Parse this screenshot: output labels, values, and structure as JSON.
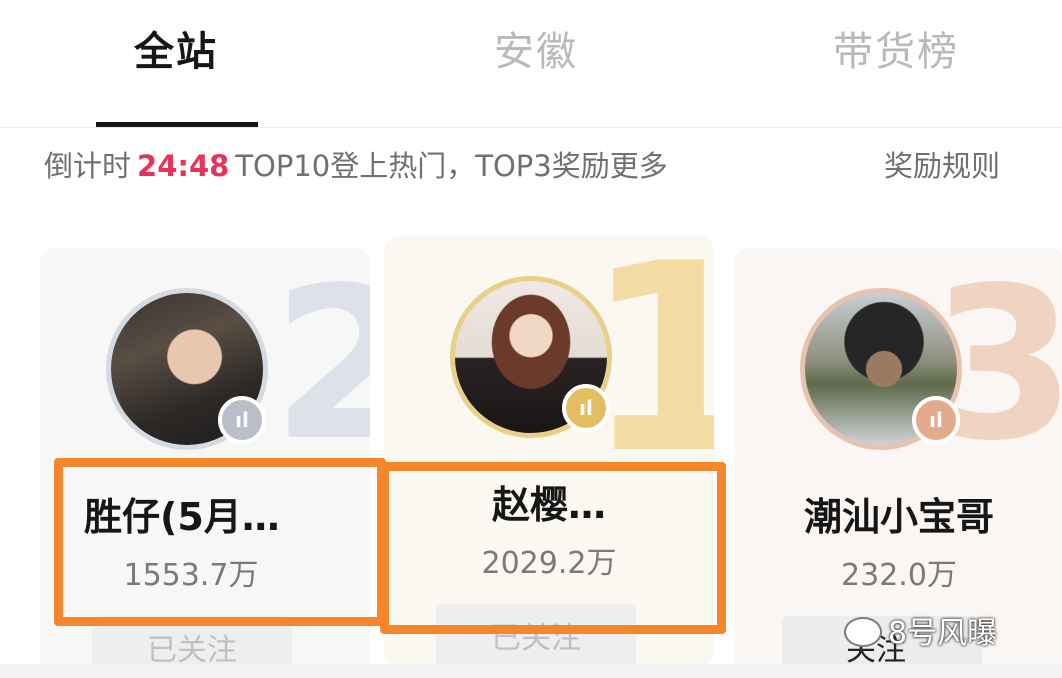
{
  "tabs": [
    {
      "label": "全站",
      "active": true
    },
    {
      "label": "安徽",
      "active": false
    },
    {
      "label": "带货榜",
      "active": false
    }
  ],
  "countdown": {
    "prefix": "倒计时",
    "time": "24:48",
    "message": "TOP10登上热门，TOP3奖励更多",
    "rules_label": "奖励规则"
  },
  "podium": {
    "second": {
      "rank": "2",
      "name": "胜仔(5月…",
      "score": "1553.7万",
      "follow_label": "已关注"
    },
    "first": {
      "rank": "1",
      "name": "赵樱…",
      "score": "2029.2万",
      "follow_label": "已关注"
    },
    "third": {
      "rank": "3",
      "name": "潮汕小宝哥",
      "score": "232.0万",
      "follow_label": "关注"
    }
  },
  "live_badge_glyph": "ıl",
  "watermark": {
    "text": "8号风曝"
  },
  "colors": {
    "accent_countdown": "#e8335a",
    "highlight_box": "#f5862a",
    "gold": "#e3bf62",
    "silver": "#b9bec8",
    "bronze": "#e2ab8b"
  }
}
